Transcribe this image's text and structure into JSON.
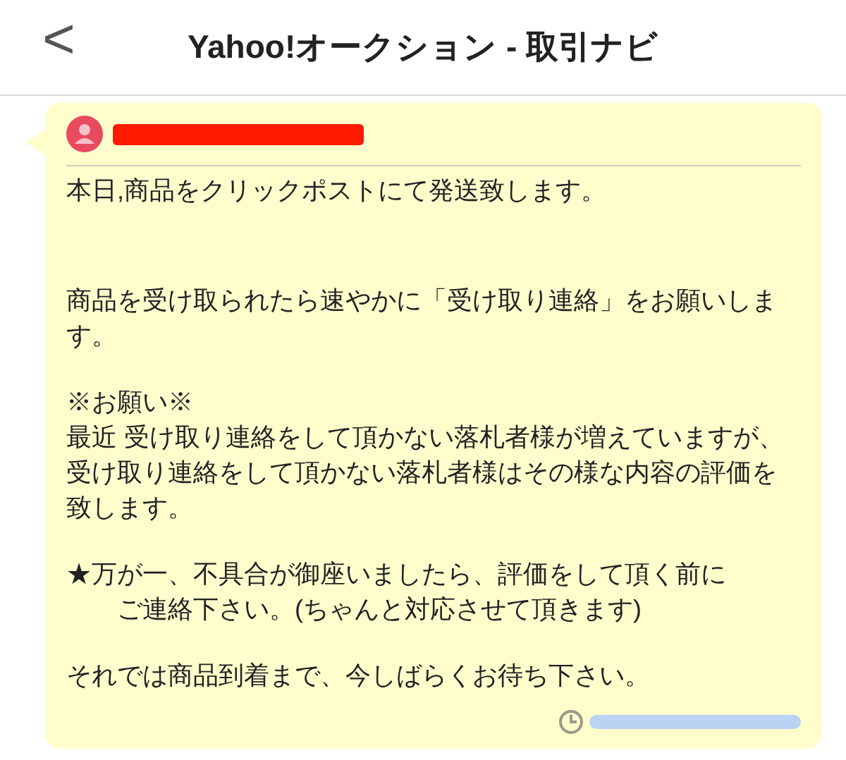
{
  "header": {
    "back": "<",
    "title": "Yahoo!オークション - 取引ナビ"
  },
  "message": {
    "sender_redacted": true,
    "time_redacted": true,
    "paragraphs": [
      {
        "lines": [
          "本日,商品をクリックポストにて発送致します。"
        ]
      },
      {
        "lines": [
          "商品を受け取られたら速やかに「受け取り連絡」をお願いしま",
          "す。"
        ]
      },
      {
        "lines": [
          "※お願い※",
          "最近 受け取り連絡をして頂かない落札者様が増えていますが、",
          "受け取り連絡をして頂かない落札者様はその様な内容の評価を",
          "致します。"
        ]
      },
      {
        "lines": [
          "★万が一、不具合が御座いましたら、評価をして頂く前に",
          "　　ご連絡下さい。(ちゃんと対応させて頂きます)"
        ]
      },
      {
        "lines": [
          "それでは商品到着まで、今しばらくお待ち下さい。"
        ]
      }
    ]
  }
}
